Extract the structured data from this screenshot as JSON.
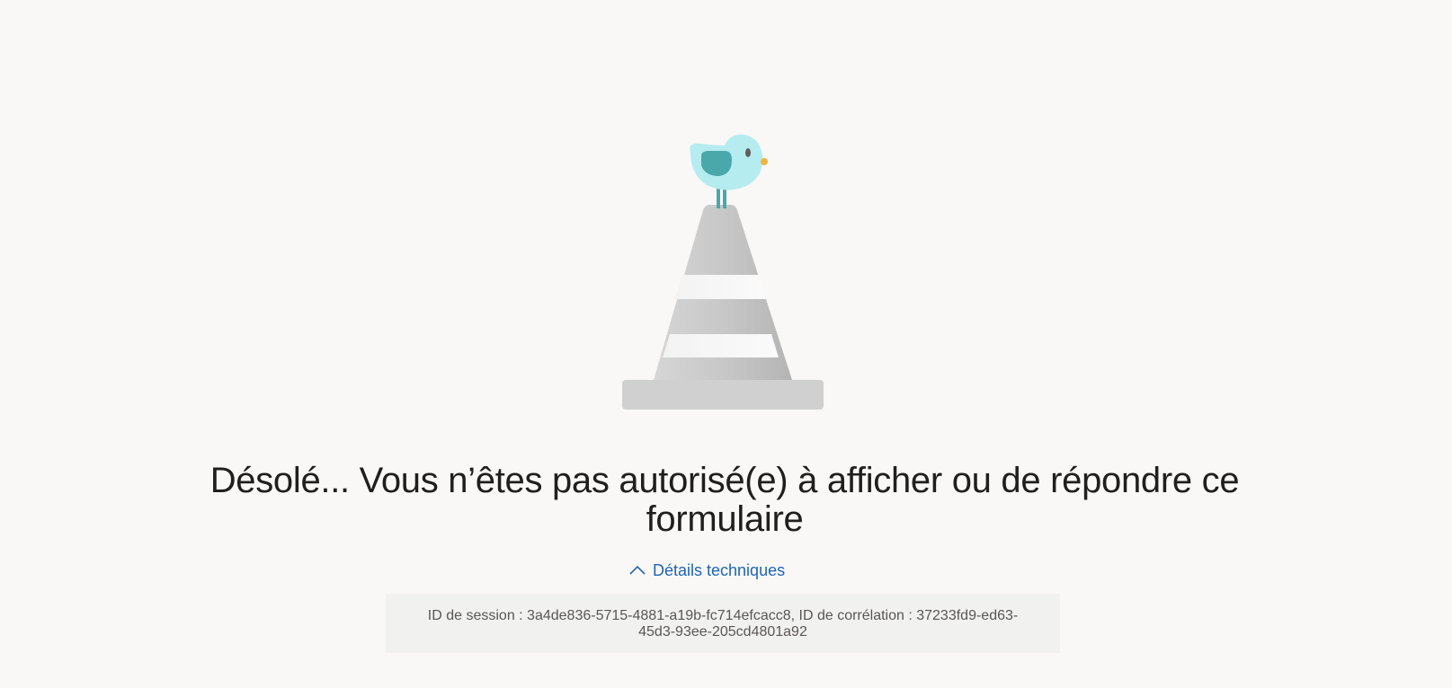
{
  "error": {
    "title": "Désolé... Vous n’êtes pas autorisé(e) à afficher ou de répondre ce formulaire",
    "details_toggle_label": "Détails techniques",
    "technical_details": "ID de session : 3a4de836-5715-4881-a19b-fc714efcacc8, ID de corrélation : 37233fd9-ed63-45d3-93ee-205cd4801a92"
  },
  "icons": {
    "illustration": "bird-on-traffic-cone-illustration",
    "toggle": "chevron-up-icon"
  },
  "colors": {
    "background": "#f9f8f7",
    "link": "#1f64b5",
    "title": "#201f1e",
    "details_background": "#f1f1f0",
    "bird": "#b4ecef",
    "bird_wing": "#4aa8aa",
    "cone": "#c8c8c8"
  }
}
